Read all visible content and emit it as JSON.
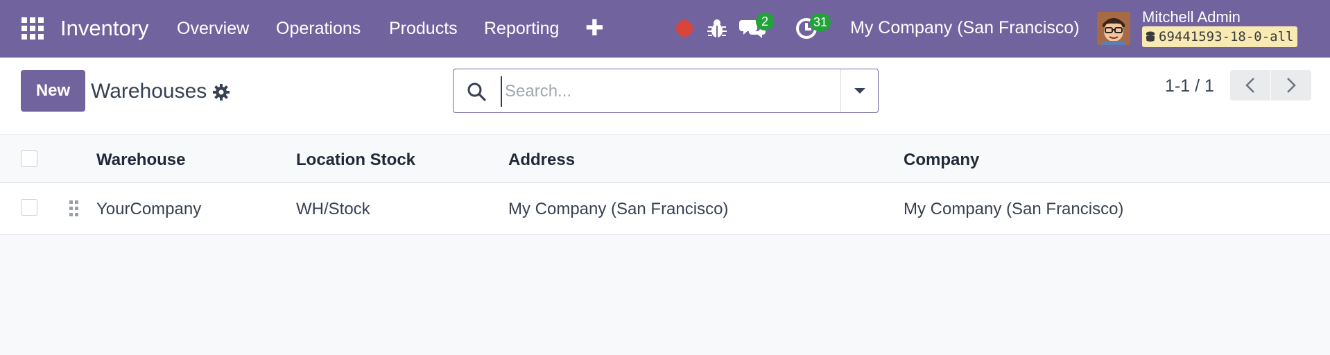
{
  "navbar": {
    "app_name": "Inventory",
    "menu": [
      "Overview",
      "Operations",
      "Products",
      "Reporting"
    ],
    "plus": "✚",
    "messages_count": "2",
    "activities_count": "31",
    "company": "My Company (San Francisco)",
    "user_name": "Mitchell Admin",
    "database": "69441593-18-0-all",
    "colors": {
      "bar": "#71639e",
      "badge": "#21a339",
      "record_dot": "#d9453b"
    }
  },
  "control_panel": {
    "new_label": "New",
    "title": "Warehouses",
    "search_placeholder": "Search...",
    "pager": "1-1 / 1"
  },
  "list": {
    "columns": [
      "Warehouse",
      "Location Stock",
      "Address",
      "Company"
    ],
    "rows": [
      {
        "warehouse": "YourCompany",
        "location_stock": "WH/Stock",
        "address": "My Company (San Francisco)",
        "company": "My Company (San Francisco)"
      }
    ]
  }
}
